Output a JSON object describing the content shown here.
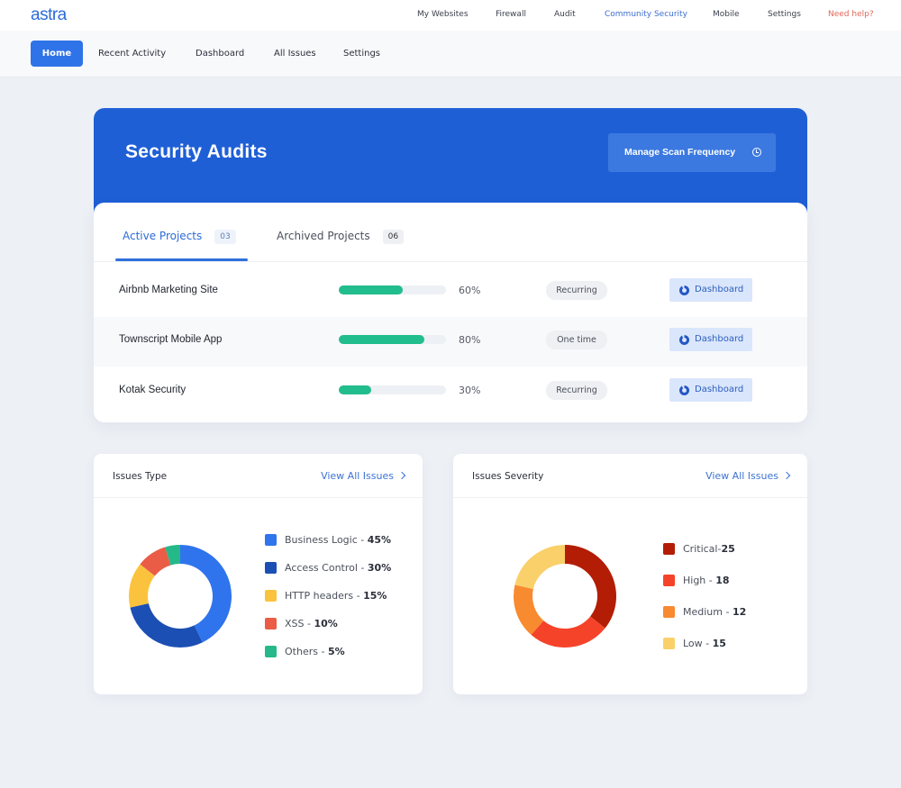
{
  "topbar": {
    "logo": "astra",
    "nav": [
      {
        "label": "My Websites",
        "active": false
      },
      {
        "label": "Firewall",
        "active": false
      },
      {
        "label": "Audit",
        "active": false
      },
      {
        "label": "Community Security",
        "active": true
      },
      {
        "label": "Mobile",
        "active": false
      },
      {
        "label": "Settings",
        "active": false
      },
      {
        "label": "Need help?",
        "active": false
      }
    ]
  },
  "subnav": {
    "items": [
      {
        "label": "Home",
        "active": true
      },
      {
        "label": "Recent Activity",
        "active": false
      },
      {
        "label": "Dashboard",
        "active": false
      },
      {
        "label": "All Issues",
        "active": false
      },
      {
        "label": "Settings",
        "active": false
      }
    ]
  },
  "hero": {
    "title": "Security Audits",
    "scan_button": "Manage Scan Frequency"
  },
  "projects": {
    "tabs": [
      {
        "label": "Active Projects",
        "count": "03",
        "active": true
      },
      {
        "label": "Archived Projects",
        "count": "06",
        "active": false
      }
    ],
    "rows": [
      {
        "name": "Airbnb Marketing Site",
        "progress": 60,
        "progress_label": "60%",
        "type": "Recurring",
        "action": "Dashboard"
      },
      {
        "name": "Townscript Mobile App",
        "progress": 80,
        "progress_label": "80%",
        "type": "One time",
        "action": "Dashboard"
      },
      {
        "name": "Kotak Security",
        "progress": 30,
        "progress_label": "30%",
        "type": "Recurring",
        "action": "Dashboard"
      }
    ]
  },
  "colors": {
    "accent": "#2f73e8",
    "hero": "#1f5fd6",
    "progress": "#22bd8c",
    "help": "#e0665a"
  },
  "chart_data": [
    {
      "type": "pie",
      "title": "Issues Type",
      "link": "View All Issues",
      "categories": [
        "Business Logic",
        "Access Control",
        "HTTP headers",
        "XSS",
        "Others"
      ],
      "values": [
        45,
        30,
        15,
        10,
        5
      ],
      "value_labels": [
        "45%",
        "30%",
        "15%",
        "10%",
        "5%"
      ],
      "colors": [
        "#2f74ec",
        "#1c4fb4",
        "#fbc33d",
        "#ea5c45",
        "#25b98a"
      ],
      "legend": "right"
    },
    {
      "type": "pie",
      "title": "Issues Severity",
      "link": "View All Issues",
      "categories": [
        "Critical",
        "High",
        "Medium",
        "Low"
      ],
      "values": [
        25,
        18,
        12,
        15
      ],
      "legend_labels": [
        "Critical-",
        "High - ",
        "Medium - ",
        "Low - "
      ],
      "value_labels": [
        "25",
        "18",
        "12",
        "15"
      ],
      "colors": [
        "#b31d05",
        "#f5432a",
        "#f88a30",
        "#f9d06a"
      ],
      "legend": "right"
    }
  ]
}
